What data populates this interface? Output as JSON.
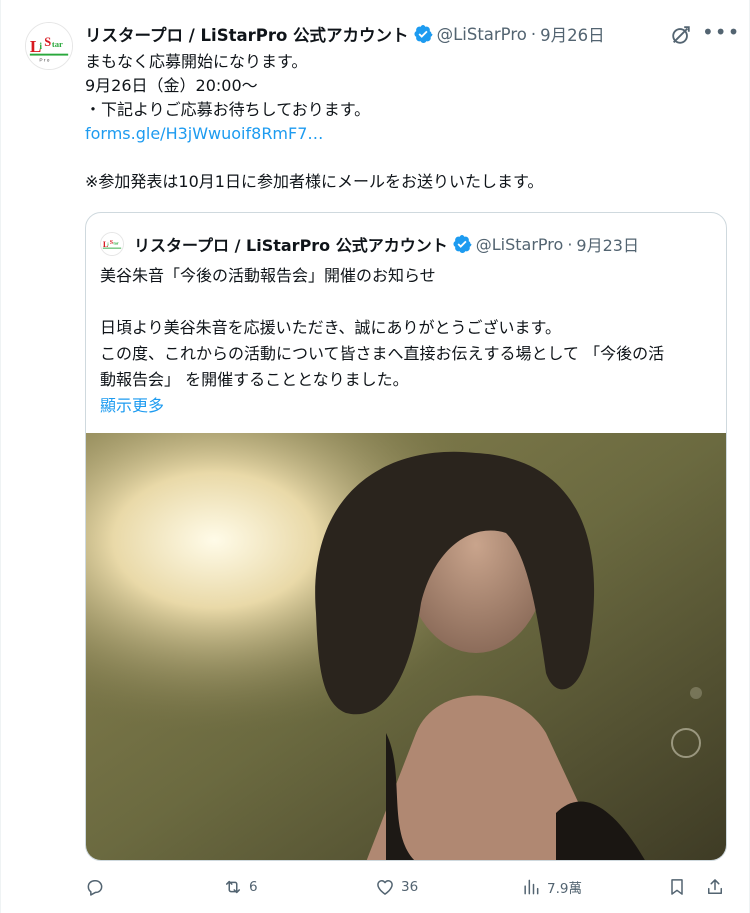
{
  "tweet": {
    "author_name": "リスタープロ / LiStarPro 公式アカウント",
    "handle": "@LiStarPro",
    "separator": "·",
    "date": "9月26日",
    "lines": [
      "まもなく応募開始になります。",
      "9月26日（金）20:00〜",
      "・下記よりご応募お待ちしております。"
    ],
    "link_text": "forms.gle/H3jWwuoif8RmF7…",
    "note": "※参加発表は10月1日に参加者様にメールをお送りいたします。",
    "avatar_text": "LiStar"
  },
  "quote": {
    "author_name": "リスタープロ / LiStarPro 公式アカウント",
    "handle": "@LiStarPro",
    "separator": "·",
    "date": "9月23日",
    "title": "美谷朱音「今後の活動報告会」開催のお知らせ",
    "lines": [
      "日頃より美谷朱音を応援いただき、誠にありがとうございます。",
      "この度、これからの活動について皆さまへ直接お伝えする場として 「今後の活",
      "動報告会」 を開催することとなりました。"
    ],
    "show_more": "顯示更多"
  },
  "actions": {
    "reply_count": "",
    "retweet_count": "6",
    "like_count": "36",
    "views_count": "7.9萬"
  },
  "colors": {
    "link": "#1d9bf0",
    "verified": "#1d9bf0",
    "muted": "#536471"
  }
}
